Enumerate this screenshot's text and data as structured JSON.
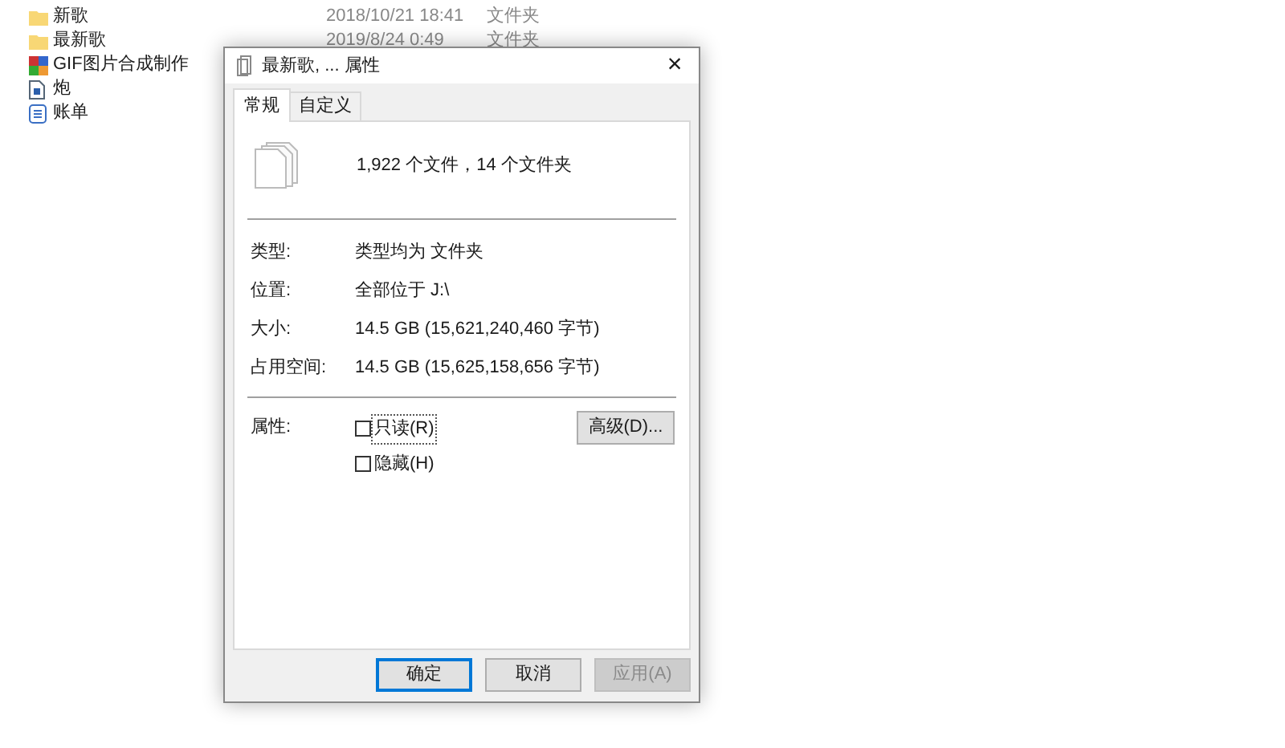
{
  "file_list": [
    {
      "kind": "folder",
      "name": "新歌",
      "date": "2018/10/21 18:41",
      "type": "文件夹"
    },
    {
      "kind": "folder",
      "name": "最新歌",
      "date": "2019/8/24 0:49",
      "type": "文件夹"
    },
    {
      "kind": "app",
      "name": "GIF图片合成制作"
    },
    {
      "kind": "image",
      "name": "炮"
    },
    {
      "kind": "doc",
      "name": "账单"
    }
  ],
  "dialog": {
    "title": "最新歌, ... 属性",
    "close": "×",
    "tabs": [
      {
        "label": "常规",
        "selected": true
      },
      {
        "label": "自定义",
        "selected": false
      }
    ],
    "summary": "1,922 个文件，14 个文件夹",
    "fields": [
      {
        "label": "类型:",
        "value": "类型均为 文件夹"
      },
      {
        "label": "位置:",
        "value": "全部位于 J:\\"
      },
      {
        "label": "大小:",
        "value": "14.5 GB (15,621,240,460 字节)"
      },
      {
        "label": "占用空间:",
        "value": "14.5 GB (15,625,158,656 字节)"
      }
    ],
    "attributes_label": "属性:",
    "attributes": [
      {
        "label": "只读(R)",
        "checked": false,
        "focused": true
      },
      {
        "label": "隐藏(H)",
        "checked": false,
        "focused": false
      }
    ],
    "advanced_button": "高级(D)...",
    "buttons": [
      {
        "label": "确定",
        "kind": "default",
        "disabled": false
      },
      {
        "label": "取消",
        "kind": "normal",
        "disabled": false
      },
      {
        "label": "应用(A)",
        "kind": "normal",
        "disabled": true
      }
    ]
  }
}
